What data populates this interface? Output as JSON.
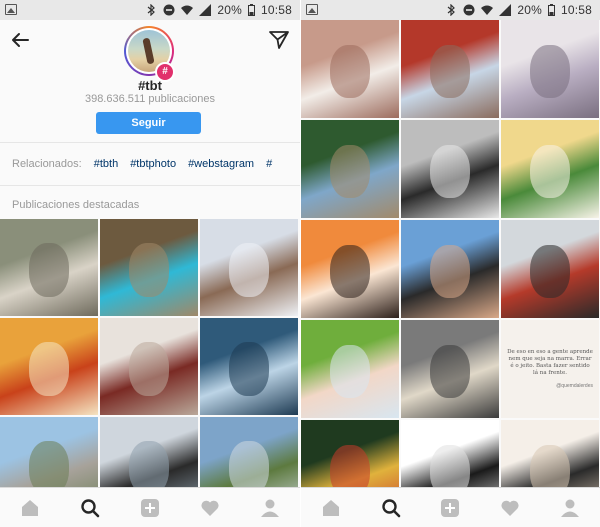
{
  "status_bar": {
    "battery": "20%",
    "time": "10:58"
  },
  "hashtag_page": {
    "title": "#tbt",
    "post_count": "398.636.511 publicaciones",
    "follow_label": "Seguir",
    "related_label": "Relacionados:",
    "related_tags": [
      "#tbth",
      "#tbtphoto",
      "#webstagram",
      "#"
    ],
    "featured_label": "Publicaciones destacadas",
    "avatar_badge": "#"
  },
  "left_tiles": [
    {
      "name": "goats",
      "colors": [
        "#8a8f7a",
        "#d9d3c7",
        "#6e6a5c"
      ]
    },
    {
      "name": "cave-pool",
      "colors": [
        "#6d5a3f",
        "#2fb9d6",
        "#a08868"
      ]
    },
    {
      "name": "dog-snow",
      "colors": [
        "#d7dde6",
        "#8a6a55",
        "#eef1f5"
      ]
    },
    {
      "name": "noodles",
      "colors": [
        "#e9a23b",
        "#c9421a",
        "#f4e4c2"
      ]
    },
    {
      "name": "table-setting",
      "colors": [
        "#e8e2dc",
        "#7a2a24",
        "#b9a89a"
      ]
    },
    {
      "name": "frozen-forest",
      "colors": [
        "#2f5a7a",
        "#bcd4e6",
        "#1d3a52"
      ]
    },
    {
      "name": "castle",
      "colors": [
        "#9cc3e3",
        "#a7a29a",
        "#6c7d56"
      ]
    },
    {
      "name": "couple-window",
      "colors": [
        "#cfd6dd",
        "#2a2a2a",
        "#8fa0ad"
      ]
    },
    {
      "name": "mountain",
      "colors": [
        "#7da4c9",
        "#5d7a3f",
        "#cfd8de"
      ]
    }
  ],
  "right_tiles": [
    {
      "name": "woman-fitness",
      "colors": [
        "#c79a8a",
        "#f2ede8",
        "#9c6b5d"
      ]
    },
    {
      "name": "city-square",
      "colors": [
        "#b4382a",
        "#c7d6e6",
        "#8a6b5d"
      ]
    },
    {
      "name": "kitten",
      "colors": [
        "#e9e4e8",
        "#b9aec2",
        "#7a6f80"
      ]
    },
    {
      "name": "pine-forest",
      "colors": [
        "#2e5a2f",
        "#7fa7c9",
        "#a28a6a"
      ]
    },
    {
      "name": "bw-couple",
      "colors": [
        "#bdbdbd",
        "#2a2a2a",
        "#e8e8e8"
      ]
    },
    {
      "name": "dumplings",
      "colors": [
        "#f0d88c",
        "#4a8a3a",
        "#f7f3e8"
      ]
    },
    {
      "name": "sushi",
      "colors": [
        "#f08a3c",
        "#fbe6d3",
        "#2c1f1a"
      ]
    },
    {
      "name": "young-man",
      "colors": [
        "#6aa0d6",
        "#2a2a2a",
        "#d9a888"
      ]
    },
    {
      "name": "man-sunglasses",
      "colors": [
        "#d3d8dc",
        "#b53a2a",
        "#2a2a2a"
      ]
    },
    {
      "name": "girl-grass",
      "colors": [
        "#6fae3c",
        "#f2d7c7",
        "#d8e6f0"
      ]
    },
    {
      "name": "man-street",
      "colors": [
        "#7a7a7a",
        "#e0d8c8",
        "#3a3a3a"
      ]
    },
    {
      "name": "quote-card",
      "colors": [
        "#f5f1ec",
        "#f5f1ec",
        "#f5f1ec"
      ]
    },
    {
      "name": "festival",
      "colors": [
        "#1f3a1f",
        "#e0b23c",
        "#c73a2a"
      ]
    },
    {
      "name": "silhouette",
      "colors": [
        "#ffffff",
        "#1a1a1a",
        "#e0e0e0"
      ]
    },
    {
      "name": "woman-house",
      "colors": [
        "#f5efe8",
        "#2a2a2a",
        "#d7c6b2"
      ]
    }
  ],
  "quote_card": {
    "text": "De eso en eso a gente aprende nem que seja na marra. Errar é o jeito. Basta fazer sentido lá na frente.",
    "handle": "@quemdalerdes"
  },
  "tabs": [
    "home",
    "search",
    "add",
    "activity",
    "profile"
  ]
}
